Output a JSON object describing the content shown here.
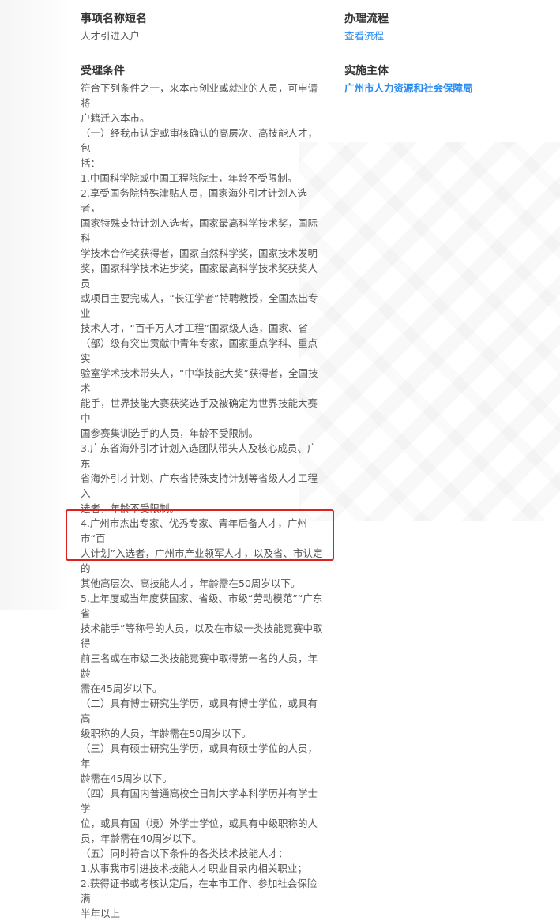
{
  "item": {
    "label": "事项名称短名",
    "value": "人才引进入户"
  },
  "process": {
    "label": "办理流程",
    "link": "查看流程"
  },
  "conditions": {
    "label": "受理条件",
    "lines": [
      "符合下列条件之一，来本市创业或就业的人员，可申请将",
      "户籍迁入本市。",
      "（一）经我市认定或审核确认的高层次、高技能人才，包",
      "括：",
      "1.中国科学院或中国工程院院士，年龄不受限制。",
      "2.享受国务院特殊津贴人员，国家海外引才计划入选者，",
      "国家特殊支持计划入选者，国家最高科学技术奖，国际科",
      "学技术合作奖获得者，国家自然科学奖，国家技术发明",
      "奖，国家科学技术进步奖，国家最高科学技术奖获奖人员",
      "或项目主要完成人，“长江学者”特聘教授，全国杰出专业",
      "技术人才，“百千万人才工程”国家级人选，国家、省",
      "（部）级有突出贡献中青年专家，国家重点学科、重点实",
      "验室学术技术带头人，“中华技能大奖”获得者，全国技术",
      "能手，世界技能大赛获奖选手及被确定为世界技能大赛中",
      "国参赛集训选手的人员，年龄不受限制。",
      "3.广东省海外引才计划入选团队带头人及核心成员、广东",
      "省海外引才计划、广东省特殊支持计划等省级人才工程入",
      "选者，年龄不受限制。",
      "4.广州市杰出专家、优秀专家、青年后备人才，广州市“百",
      "人计划”入选者，广州市产业领军人才，以及省、市认定的",
      "其他高层次、高技能人才，年龄需在50周岁以下。",
      "5.上年度或当年度获国家、省级、市级“劳动模范”“广东省",
      "技术能手”等称号的人员，以及在市级一类技能竞赛中取得",
      "前三名或在市级二类技能竞赛中取得第一名的人员，年龄",
      "需在45周岁以下。",
      "（二）具有博士研究生学历，或具有博士学位，或具有高",
      "级职称的人员，年龄需在50周岁以下。",
      "（三）具有硕士研究生学历，或具有硕士学位的人员，年",
      "龄需在45周岁以下。",
      "（四）具有国内普通高校全日制大学本科学历并有学士学",
      "位，或具有国（境）外学士学位，或具有中级职称的人",
      "员，年龄需在40周岁以下。",
      "（五）同时符合以下条件的各类技术技能人才：",
      "1.从事我市引进技术技能人才职业目录内相关职业；",
      "2.获得证书或考核认定后，在本市工作、参加社会保险满",
      "半年以上"
    ]
  },
  "authority": {
    "label": "实施主体",
    "link": "广州市人力资源和社会保障局"
  },
  "colors": {
    "link": "#2d8cf0",
    "highlight": "#e02020",
    "label": "#333333",
    "text": "#555555"
  }
}
